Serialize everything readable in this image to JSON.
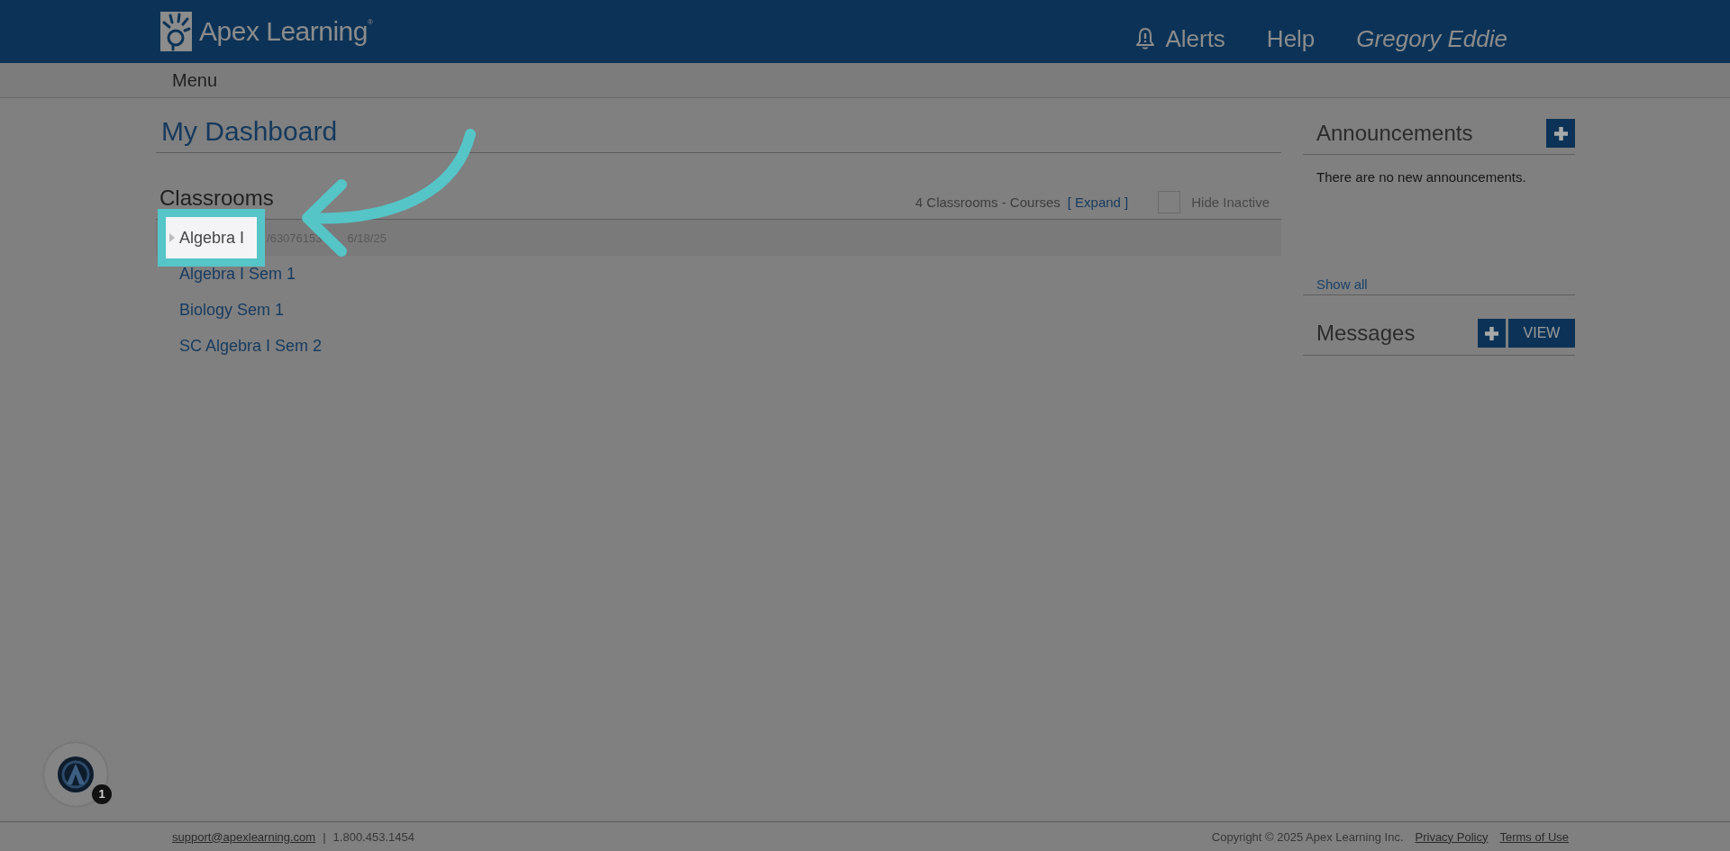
{
  "header": {
    "logo": {
      "text": "Apex Learning$^{®}$"
    },
    "nav": [
      {
        "kind": "alerts",
        "label": "Alerts"
      },
      {
        "kind": "link",
        "label": "Help"
      },
      {
        "kind": "user",
        "label": "Gregory Eddie"
      }
    ]
  },
  "menu_bar": {
    "label": "Menu"
  },
  "dashboard": {
    "title": "My Dashboard"
  },
  "classrooms": {
    "title": "Classrooms",
    "summary": "4 Classrooms - Courses",
    "expand_link": "[ Expand ]",
    "hide_inactive": {
      "label": "Hide Inactive",
      "checked": false
    },
    "items": [
      {
        "name": "Algebra I",
        "selected": true,
        "highlighted": true,
        "code": "/63076153",
        "date": "6/18/25"
      },
      {
        "name": "Algebra I Sem 1",
        "selected": false,
        "highlighted": false
      },
      {
        "name": "Biology Sem 1",
        "selected": false,
        "highlighted": false
      },
      {
        "name": "SC Algebra I Sem 2",
        "selected": false,
        "highlighted": false
      }
    ]
  },
  "announcements": {
    "title": "Announcements",
    "message": "There are no new announcements.",
    "show_all": "Show all"
  },
  "messages": {
    "title": "Messages",
    "view_button": "VIEW"
  },
  "footer": {
    "email": "support@apexlearning.com",
    "separator": "|",
    "phone": "1.800.453.1454",
    "copyright": "Copyright © 2025 Apex Learning Inc.",
    "links": [
      "Privacy Policy",
      "Terms of Use"
    ]
  },
  "assistant": {
    "badge": "1"
  }
}
